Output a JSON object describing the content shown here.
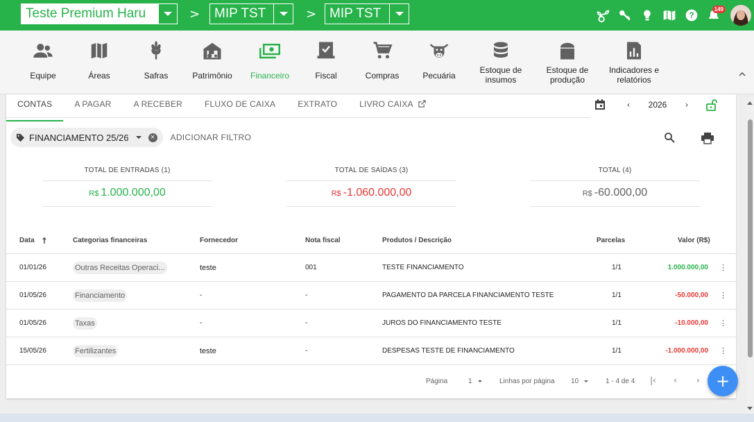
{
  "topbar": {
    "farm": "Teste Premium Haru",
    "crop1": "MIP TST",
    "crop2": "MIP TST",
    "separator": ">",
    "notifications": "149",
    "colors": {
      "bar": "#27b24a"
    }
  },
  "modules": [
    {
      "label": "Equipe",
      "icon": "team-icon"
    },
    {
      "label": "Áreas",
      "icon": "map-icon"
    },
    {
      "label": "Safras",
      "icon": "wheat-icon"
    },
    {
      "label": "Patrimônio",
      "icon": "barn-tractor-icon"
    },
    {
      "label": "Financeiro",
      "icon": "money-icon",
      "active": true
    },
    {
      "label": "Fiscal",
      "icon": "fiscal-icon"
    },
    {
      "label": "Compras",
      "icon": "cart-icon"
    },
    {
      "label": "Pecuária",
      "icon": "cow-icon"
    },
    {
      "label": "Estoque de insumos",
      "icon": "database-icon"
    },
    {
      "label": "Estoque de produção",
      "icon": "silo-icon"
    },
    {
      "label": "Indicadores e relatórios",
      "icon": "report-icon"
    }
  ],
  "tabs": [
    "CONTAS",
    "A PAGAR",
    "A RECEBER",
    "FLUXO DE CAIXA",
    "EXTRATO",
    "LIVRO CAIXA"
  ],
  "year": "2026",
  "filter": {
    "chip": "FINANCIAMENTO 25/26",
    "add": "ADICIONAR FILTRO"
  },
  "totals": {
    "entradas": {
      "label": "TOTAL DE ENTRADAS (1)",
      "currency": "R$",
      "value": "1.000.000,00"
    },
    "saidas": {
      "label": "TOTAL DE SAÍDAS (3)",
      "currency": "R$",
      "value": "-1.060.000,00"
    },
    "total": {
      "label": "TOTAL (4)",
      "currency": "R$",
      "value": "-60.000,00"
    }
  },
  "table": {
    "headers": {
      "data": "Data",
      "categorias": "Categorias financeiras",
      "fornecedor": "Fornecedor",
      "nota": "Nota fiscal",
      "produtos": "Produtos / Descrição",
      "parcelas": "Parcelas",
      "valor": "Valor (R$)"
    },
    "sort_arrow": "↑",
    "rows": [
      {
        "data": "01/01/26",
        "categoria": "Outras Receitas Operaci...",
        "fornecedor": "teste",
        "nota": "001",
        "produto": "TESTE FINANCIAMENTO",
        "parcelas": "1/1",
        "valor": "1.000.000,00",
        "tipo": "entrada"
      },
      {
        "data": "01/05/26",
        "categoria": "Financiamento",
        "fornecedor": "-",
        "nota": "-",
        "produto": "PAGAMENTO DA PARCELA FINANCIAMENTO TESTE",
        "parcelas": "1/1",
        "valor": "-50.000,00",
        "tipo": "saida"
      },
      {
        "data": "01/05/26",
        "categoria": "Taxas",
        "fornecedor": "-",
        "nota": "-",
        "produto": "JUROS DO FINANCIAMENTO TESTE",
        "parcelas": "1/1",
        "valor": "-10.000,00",
        "tipo": "saida"
      },
      {
        "data": "15/05/26",
        "categoria": "Fertilizantes",
        "fornecedor": "teste",
        "nota": "-",
        "produto": "DESPESAS TESTE DE FINANCIAMENTO",
        "parcelas": "1/1",
        "valor": "-1.000.000,00",
        "tipo": "saida"
      }
    ]
  },
  "pager": {
    "page_label": "Página",
    "page": "1",
    "rows_label": "Linhas por página",
    "rows_per_page": "10",
    "range": "1 - 4 de 4"
  },
  "fab": "+"
}
